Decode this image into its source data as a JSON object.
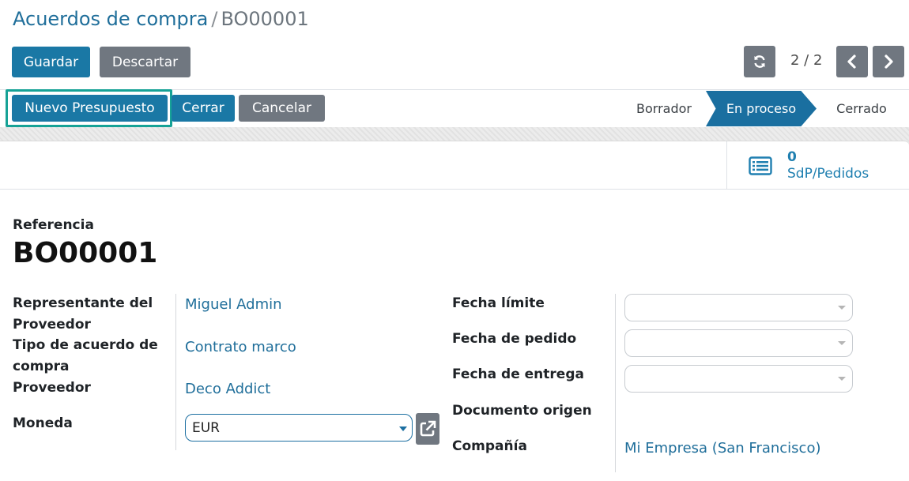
{
  "breadcrumb": {
    "parent": "Acuerdos de compra",
    "separator": "/",
    "current": "BO00001"
  },
  "actions": {
    "save": "Guardar",
    "discard": "Descartar"
  },
  "pager": {
    "value": "2 / 2"
  },
  "workflow_buttons": {
    "new_quotation": "Nuevo Presupuesto",
    "close": "Cerrar",
    "cancel": "Cancelar"
  },
  "statusbar": {
    "stages": [
      "Borrador",
      "En proceso",
      "Cerrado"
    ],
    "active": "En proceso"
  },
  "smart_button": {
    "count": "0",
    "label": "SdP/Pedidos"
  },
  "form": {
    "reference_label": "Referencia",
    "reference_value": "BO00001",
    "left": {
      "representative_label_line1": "Representante del",
      "representative_label_line2": "Proveedor",
      "representative_value": "Miguel Admin",
      "agreement_type_label_line1": "Tipo de acuerdo de",
      "agreement_type_label_line2": "compra",
      "agreement_type_value": "Contrato marco",
      "vendor_label": "Proveedor",
      "vendor_value": "Deco Addict",
      "currency_label": "Moneda",
      "currency_value": "EUR"
    },
    "right": {
      "deadline_label": "Fecha límite",
      "order_date_label": "Fecha de pedido",
      "delivery_date_label": "Fecha de entrega",
      "source_document_label": "Documento origen",
      "company_label": "Compañía",
      "company_value": "Mi Empresa (San Francisco)"
    }
  },
  "colors": {
    "primary": "#1a78a5",
    "secondary": "#707780",
    "link": "#1f6e9a",
    "highlight": "#16a296"
  }
}
